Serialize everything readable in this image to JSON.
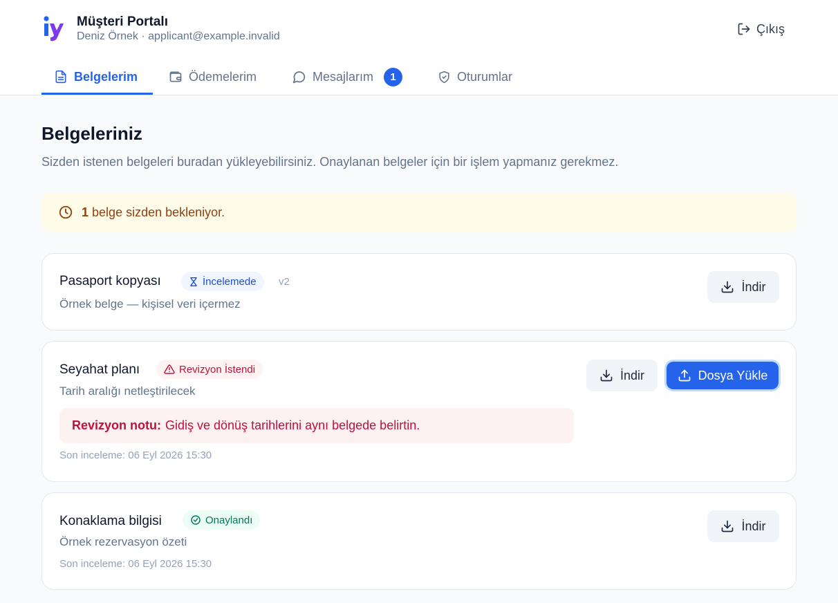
{
  "header": {
    "logo_icon": "brand-logo-icon",
    "title": "Müşteri Portalı",
    "subtitle": "Deniz Örnek · applicant@example.invalid",
    "logout_label": "Çıkış",
    "logout_icon": "logout-icon"
  },
  "tabs": [
    {
      "label": "Belgelerim",
      "icon": "document-icon",
      "active": true
    },
    {
      "label": "Ödemelerim",
      "icon": "wallet-icon",
      "active": false
    },
    {
      "label": "Mesajlarım",
      "icon": "message-icon",
      "active": false,
      "badge": "1"
    },
    {
      "label": "Oturumlar",
      "icon": "shield-icon",
      "active": false
    }
  ],
  "main": {
    "title": "Belgeleriniz",
    "description": "Sizden istenen belgeleri buradan yükleyebilirsiniz. Onaylanan belgeler için bir işlem yapmanız gerekmez.",
    "notice": {
      "count": "1",
      "text": "belge sizden bekleniyor.",
      "icon": "clock-icon"
    }
  },
  "documents": [
    {
      "title": "Pasaport kopyası",
      "status": "İncelemede",
      "status_icon": "hourglass-icon",
      "version": "v2",
      "description": "Örnek belge — kişisel veri içermez",
      "download_label": "İndir"
    },
    {
      "title": "Seyahat planı",
      "status": "Revizyon İstendi",
      "status_icon": "warning-icon",
      "description": "Tarih aralığı netleştirilecek",
      "download_label": "İndir",
      "upload_label": "Dosya Yükle",
      "revision_note_label": "Revizyon notu:",
      "revision_note_text": "Gidiş ve dönüş tarihlerini aynı belgede belirtin.",
      "last_review": "Son inceleme: 06 Eyl 2026 15:30"
    },
    {
      "title": "Konaklama bilgisi",
      "status": "Onaylandı",
      "status_icon": "check-circle-icon",
      "description": "Örnek rezervasyon özeti",
      "download_label": "İndir",
      "last_review": "Son inceleme: 06 Eyl 2026 15:30"
    }
  ],
  "colors": {
    "accent": "#2563eb",
    "warning_bg": "#fefbe8",
    "warning_text": "#92400e",
    "danger": "#be123c",
    "success": "#047857"
  }
}
